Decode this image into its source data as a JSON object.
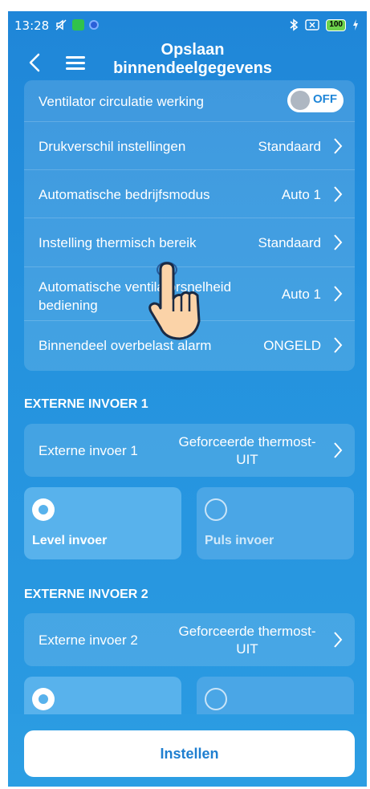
{
  "status_bar": {
    "time": "13:28",
    "battery": "100"
  },
  "header": {
    "title_line1": "Opslaan",
    "title_line2": "binnendeelgegevens",
    "back_icon": "chevron-left-icon",
    "menu_icon": "hamburger-menu-icon"
  },
  "settings": {
    "rows": [
      {
        "label": "Ventilator circulatie werking",
        "toggle": "OFF"
      },
      {
        "label": "Drukverschil instellingen",
        "value": "Standaard"
      },
      {
        "label": "Automatische bedrijfsmodus",
        "value": "Auto 1"
      },
      {
        "label": "Instelling thermisch bereik",
        "value": "Standaard"
      },
      {
        "label_line1": "Automatische ventilatorsnelheid",
        "label_line2": "bediening",
        "value": "Auto 1"
      },
      {
        "label": "Binnendeel overbelast alarm",
        "value": "ONGELD"
      }
    ]
  },
  "external_input_1": {
    "section_title": "EXTERNE INVOER 1",
    "label": "Externe invoer 1",
    "value_line1": "Geforceerde thermost-",
    "value_line2": "UIT",
    "options": [
      {
        "label": "Level invoer",
        "selected": true
      },
      {
        "label": "Puls invoer",
        "selected": false
      }
    ]
  },
  "external_input_2": {
    "section_title": "EXTERNE INVOER 2",
    "label": "Externe invoer 2",
    "value_line1": "Geforceerde thermost-",
    "value_line2": "UIT",
    "options": [
      {
        "selected": true
      },
      {
        "selected": false
      }
    ]
  },
  "footer": {
    "button_label": "Instellen"
  },
  "colors": {
    "background": "#2492de",
    "card": "#ffffff24",
    "button_text": "#1f7fd0"
  }
}
